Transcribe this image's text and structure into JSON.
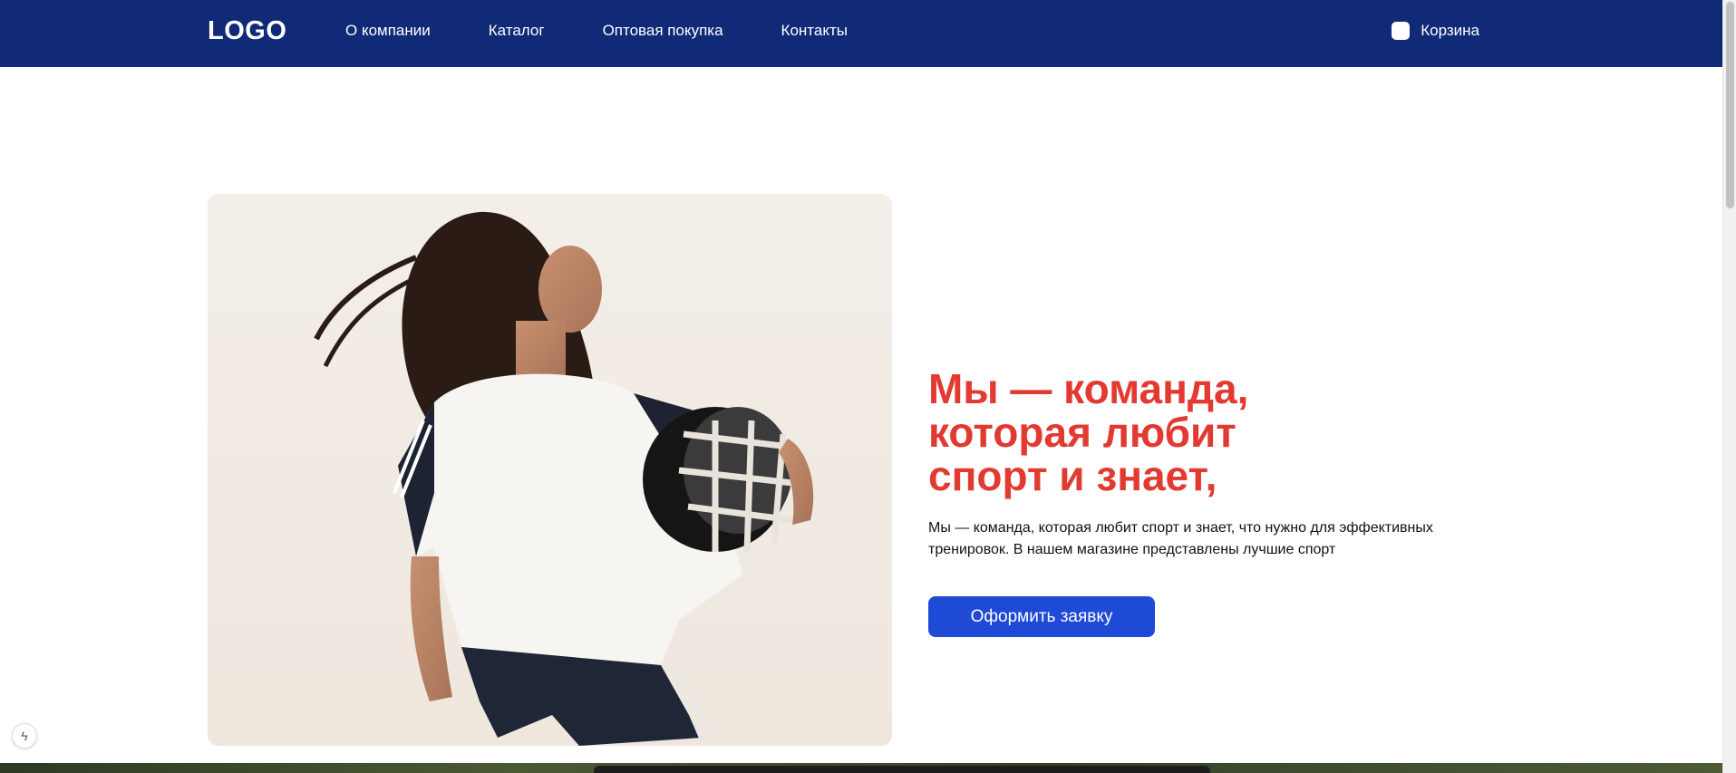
{
  "header": {
    "logo": "LOGO",
    "nav": [
      "О компании",
      "Каталог",
      "Оптовая покупка",
      "Контакты"
    ],
    "cart_label": "Корзина"
  },
  "hero": {
    "title_lines": [
      "Мы — команда,",
      "которая любит",
      "спорт и знает,"
    ],
    "text_line1": "Мы — команда, которая любит спорт и знает, что нужно для эффективных",
    "text_line2": "тренировок. В нашем магазине представлены лучшие спорт",
    "cta_label": "Оформить заявку",
    "image": "woman-in-sportswear-holding-football-helmet"
  },
  "colors": {
    "header_bg": "#102a77",
    "title": "#e23a31",
    "cta_bg": "#1e4ad6"
  },
  "widget": {
    "icon": "lightning-icon",
    "glyph": "ϟ"
  }
}
